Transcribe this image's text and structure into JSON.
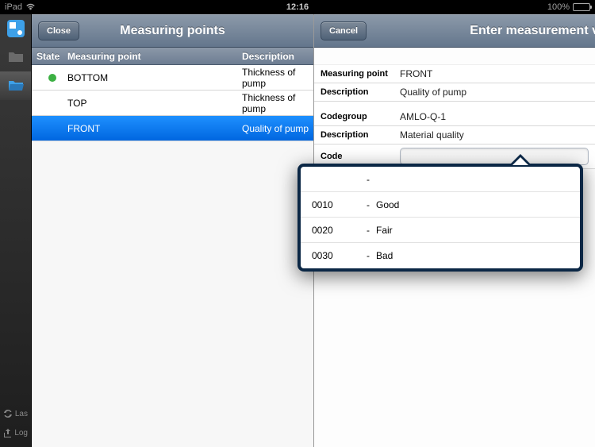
{
  "status": {
    "carrier": "iPad",
    "time": "12:16",
    "battery": "100%"
  },
  "rail": {
    "bottom_sync": "Las",
    "bottom_log": "Log"
  },
  "points_panel": {
    "title": "Measuring points",
    "close": "Close",
    "headers": {
      "state": "State",
      "point": "Measuring point",
      "desc": "Description"
    },
    "rows": [
      {
        "state_ok": true,
        "point": "BOTTOM",
        "desc": "Thickness of pump",
        "selected": false
      },
      {
        "state_ok": false,
        "point": "TOP",
        "desc": "Thickness of pump",
        "selected": false
      },
      {
        "state_ok": false,
        "point": "FRONT",
        "desc": "Quality of pump",
        "selected": true
      }
    ]
  },
  "form_panel": {
    "title": "Enter measurement v",
    "cancel": "Cancel",
    "fields": {
      "mp_label": "Measuring point",
      "mp_value": "FRONT",
      "d1_label": "Description",
      "d1_value": "Quality of pump",
      "cg_label": "Codegroup",
      "cg_value": "AMLO-Q-1",
      "d2_label": "Description",
      "d2_value": "Material quality",
      "code_label": "Code"
    }
  },
  "popover": {
    "items": [
      {
        "code": "",
        "dash": "-",
        "label": ""
      },
      {
        "code": "0010",
        "dash": "-",
        "label": "Good"
      },
      {
        "code": "0020",
        "dash": "-",
        "label": "Fair"
      },
      {
        "code": "0030",
        "dash": "-",
        "label": "Bad"
      }
    ]
  }
}
